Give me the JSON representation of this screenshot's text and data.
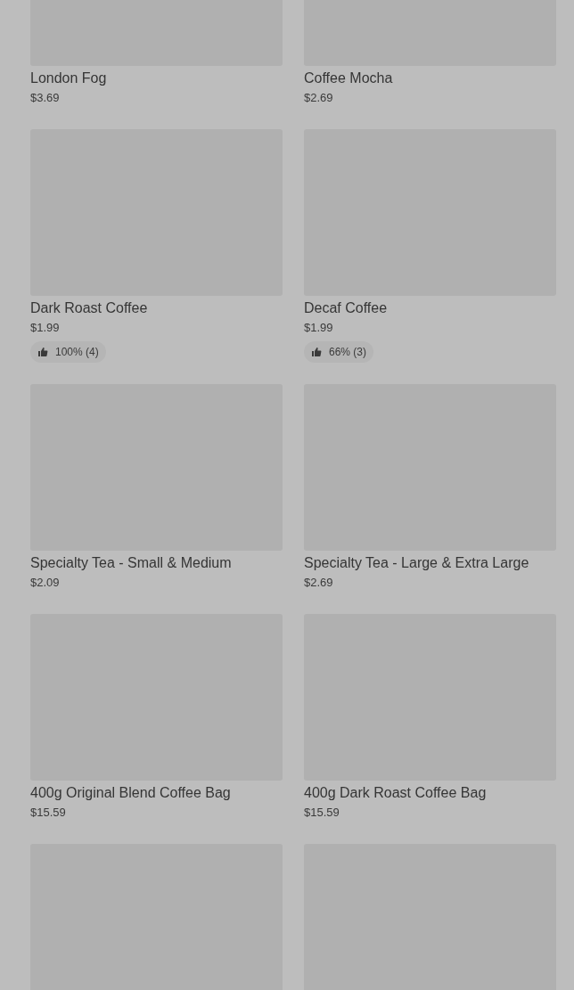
{
  "products": [
    {
      "name": "London Fog",
      "price": "$3.69"
    },
    {
      "name": "Coffee Mocha",
      "price": "$2.69"
    },
    {
      "name": "Dark Roast Coffee",
      "price": "$1.99",
      "rating": "100% (4)"
    },
    {
      "name": "Decaf Coffee",
      "price": "$1.99",
      "rating": "66% (3)"
    },
    {
      "name": "Specialty Tea - Small & Medium",
      "price": "$2.09"
    },
    {
      "name": "Specialty Tea - Large & Extra Large",
      "price": "$2.69"
    },
    {
      "name": "400g Original Blend Coffee Bag",
      "price": "$15.59"
    },
    {
      "name": "400g Dark Roast Coffee Bag",
      "price": "$15.59"
    },
    {
      "kind": "image_only"
    },
    {
      "kind": "image_only"
    }
  ]
}
